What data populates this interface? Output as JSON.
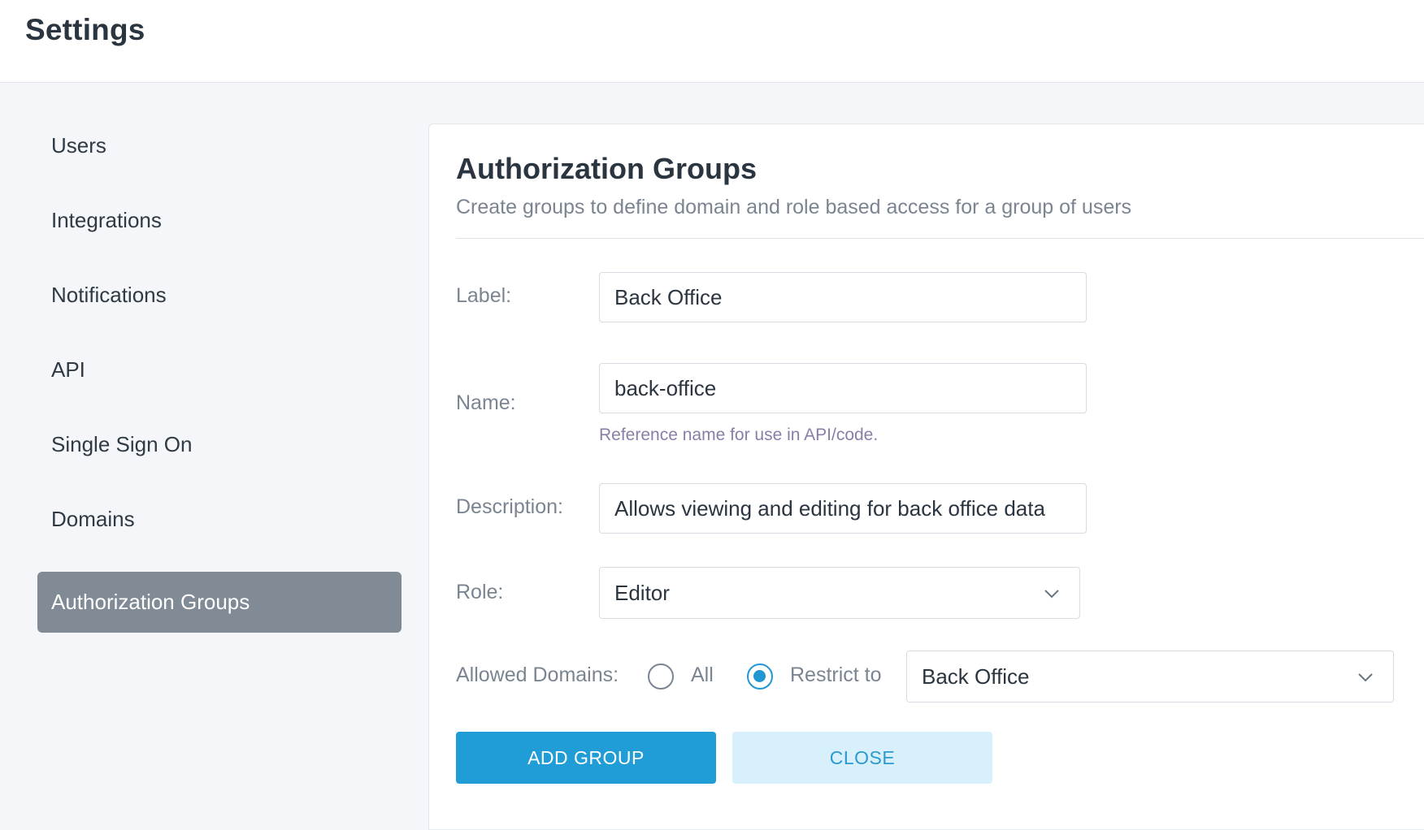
{
  "header": {
    "title": "Settings"
  },
  "sidebar": {
    "items": [
      {
        "label": "Users"
      },
      {
        "label": "Integrations"
      },
      {
        "label": "Notifications"
      },
      {
        "label": "API"
      },
      {
        "label": "Single Sign On"
      },
      {
        "label": "Domains"
      },
      {
        "label": "Authorization Groups",
        "active": true
      }
    ]
  },
  "panel": {
    "title": "Authorization Groups",
    "subtitle": "Create groups to define domain and role based access for a group of users"
  },
  "form": {
    "label": {
      "label": "Label:",
      "value": "Back Office"
    },
    "name": {
      "label": "Name:",
      "value": "back-office",
      "helper": "Reference name for use in API/code."
    },
    "description": {
      "label": "Description:",
      "value": "Allows viewing and editing for back office data"
    },
    "role": {
      "label": "Role:",
      "value": "Editor",
      "icon": "chevron-down-icon"
    },
    "allowed_domains": {
      "label": "Allowed Domains:",
      "option_all": "All",
      "option_restrict": "Restrict to",
      "selected": "Restrict to",
      "restrict_value": "Back Office",
      "icon": "chevron-down-icon"
    }
  },
  "actions": {
    "add_group_label": "ADD GROUP",
    "close_label": "CLOSE"
  },
  "colors": {
    "accent": "#209dd7",
    "sidebar_active": "#808b96",
    "secondary_button": "#d8f0fb"
  }
}
